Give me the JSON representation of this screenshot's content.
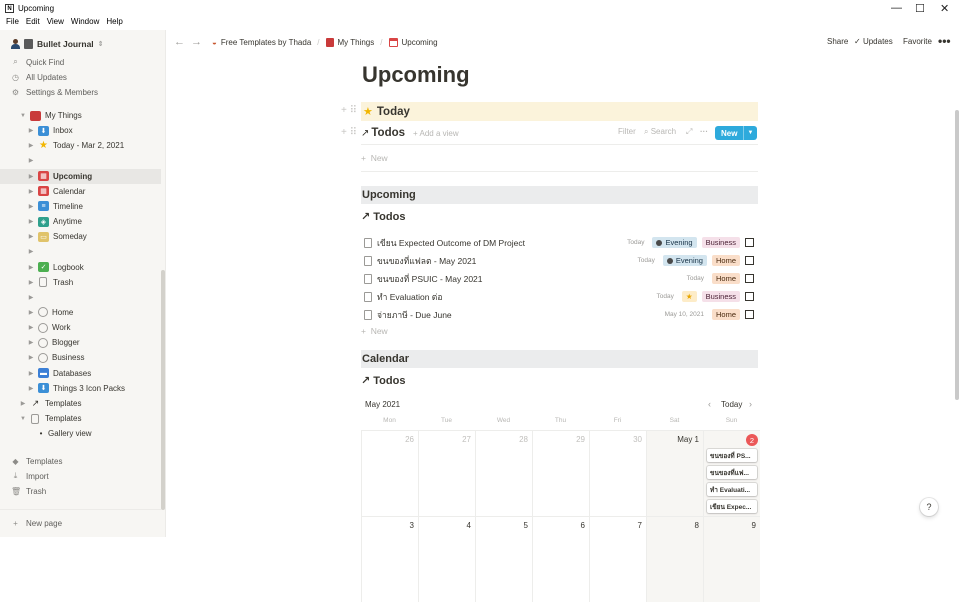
{
  "window": {
    "title": "Upcoming",
    "menu": [
      "File",
      "Edit",
      "View",
      "Window",
      "Help"
    ]
  },
  "sidebar": {
    "workspace": "Bullet Journal",
    "top": [
      {
        "label": "Quick Find",
        "icon": "search-icon"
      },
      {
        "label": "All Updates",
        "icon": "clock-icon"
      },
      {
        "label": "Settings & Members",
        "icon": "gear-icon"
      }
    ],
    "tree": [
      {
        "label": "My Things",
        "icon": "book-icon",
        "color": "#c93a3a",
        "indent": 1,
        "open": true
      },
      {
        "label": "Inbox",
        "icon": "inbox-icon",
        "color": "#3b8fd6",
        "indent": 2
      },
      {
        "label": "Today - Mar 2, 2021",
        "icon": "star-icon",
        "color": "#f2b600",
        "indent": 2
      },
      {
        "label": "",
        "icon": "",
        "color": "",
        "indent": 2
      },
      {
        "label": "Upcoming",
        "icon": "calendar-icon",
        "color": "#d94545",
        "indent": 2,
        "selected": true
      },
      {
        "label": "Calendar",
        "icon": "calendar-icon",
        "color": "#d94545",
        "indent": 2
      },
      {
        "label": "Timeline",
        "icon": "timeline-icon",
        "color": "#3b8fd6",
        "indent": 2
      },
      {
        "label": "Anytime",
        "icon": "layers-icon",
        "color": "#2fa08c",
        "indent": 2
      },
      {
        "label": "Someday",
        "icon": "box-icon",
        "color": "#e0c36a",
        "indent": 2
      },
      {
        "label": "",
        "icon": "",
        "color": "",
        "indent": 2
      },
      {
        "label": "Logbook",
        "icon": "check-icon",
        "color": "#4caf50",
        "indent": 2
      },
      {
        "label": "Trash",
        "icon": "trash-icon",
        "color": "#9b9a97",
        "indent": 2
      },
      {
        "label": "",
        "icon": "",
        "color": "",
        "indent": 2
      },
      {
        "label": "Home",
        "icon": "circle-icon",
        "color": "#9b9a97",
        "indent": 2
      },
      {
        "label": "Work",
        "icon": "circle-icon",
        "color": "#9b9a97",
        "indent": 2
      },
      {
        "label": "Blogger",
        "icon": "circle-icon",
        "color": "#9b9a97",
        "indent": 2
      },
      {
        "label": "Business",
        "icon": "circle-icon",
        "color": "#9b9a97",
        "indent": 2
      },
      {
        "label": "Databases",
        "icon": "folder-icon",
        "color": "#3b7fd6",
        "indent": 2
      },
      {
        "label": "Things 3 Icon Packs",
        "icon": "inbox-icon",
        "color": "#3b8fd6",
        "indent": 2
      },
      {
        "label": "Templates",
        "icon": "arrow-icon",
        "color": "#9b9a97",
        "indent": 1
      },
      {
        "label": "Templates",
        "icon": "page-icon",
        "color": "#9b9a97",
        "indent": 1,
        "open": true
      },
      {
        "label": "Gallery view",
        "icon": "bullet-icon",
        "color": "",
        "indent": 2
      }
    ],
    "bottom": [
      {
        "label": "Templates",
        "icon": "shapes-icon"
      },
      {
        "label": "Import",
        "icon": "download-icon"
      },
      {
        "label": "Trash",
        "icon": "trash-icon"
      }
    ],
    "new_page": "New page"
  },
  "topbar": {
    "crumbs": [
      "Free Templates by Thada",
      "My Things",
      "Upcoming"
    ],
    "share": "Share",
    "updates": "Updates",
    "favorite": "Favorite"
  },
  "page": {
    "title": "Upcoming",
    "today_label": "Today",
    "todos_view": "Todos",
    "add_view": "Add a view",
    "filter": "Filter",
    "search": "Search",
    "new_btn": "New",
    "new_row": "New",
    "upcoming_section": "Upcoming",
    "items": [
      {
        "title": "เขียน Expected Outcome of DM Project",
        "date": "Today",
        "tags": [
          {
            "t": "Evening",
            "k": "eve"
          },
          {
            "t": "Business",
            "k": "bus"
          }
        ]
      },
      {
        "title": "ขนของที่แฟลต - May 2021",
        "date": "Today",
        "tags": [
          {
            "t": "Evening",
            "k": "eve"
          },
          {
            "t": "Home",
            "k": "home"
          }
        ]
      },
      {
        "title": "ขนของที่ PSUIC - May 2021",
        "date": "Today",
        "tags": [
          {
            "t": "Home",
            "k": "home"
          }
        ]
      },
      {
        "title": "ทำ Evaluation ต่อ",
        "date": "Today",
        "tags": [
          {
            "t": "★",
            "k": "star"
          },
          {
            "t": "Business",
            "k": "bus"
          }
        ]
      },
      {
        "title": "จ่ายภาษี - Due June",
        "date": "May 10, 2021",
        "tags": [
          {
            "t": "Home",
            "k": "home"
          }
        ]
      }
    ],
    "calendar_section": "Calendar",
    "calendar": {
      "month": "May 2021",
      "today_btn": "Today",
      "days": [
        "Mon",
        "Tue",
        "Wed",
        "Thu",
        "Fri",
        "Sat",
        "Sun"
      ],
      "row1": [
        "26",
        "27",
        "28",
        "29",
        "30",
        "May 1",
        "2"
      ],
      "row2": [
        "3",
        "4",
        "5",
        "6",
        "7",
        "8",
        "9"
      ],
      "cards": [
        "ขนของที่ PS...",
        "ขนของที่แฟ...",
        "ทำ Evaluati...",
        "เขียน Expec..."
      ]
    }
  },
  "help": "?"
}
